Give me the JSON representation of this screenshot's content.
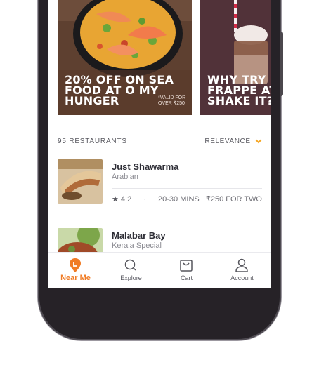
{
  "colors": {
    "accent": "#f07c26",
    "chevron": "#f5a623",
    "text_dark": "#2e2e36",
    "text_muted": "#8c8c93"
  },
  "banners": [
    {
      "text": "20% OFF ON SEA FOOD AT O MY HUNGER",
      "note": "*VALID FOR OVER ₹250"
    },
    {
      "text": "WHY TRY FRAPPE AT SHAKE IT?"
    }
  ],
  "list": {
    "count_label": "95 RESTAURANTS",
    "sort_label": "RELEVANCE",
    "sort_icon": "chevron-down-icon"
  },
  "restaurants": [
    {
      "name": "Just Shawarma",
      "cuisine": "Arabian",
      "rating": "4.2",
      "time": "20-30 MINS",
      "price": "₹250 FOR TWO"
    },
    {
      "name": "Malabar Bay",
      "cuisine": "Kerala Special"
    }
  ],
  "tabs": [
    {
      "label": "Near Me",
      "icon": "location-pin-icon",
      "active": true
    },
    {
      "label": "Explore",
      "icon": "search-icon",
      "active": false
    },
    {
      "label": "Cart",
      "icon": "cart-bag-icon",
      "active": false
    },
    {
      "label": "Account",
      "icon": "user-icon",
      "active": false
    }
  ]
}
